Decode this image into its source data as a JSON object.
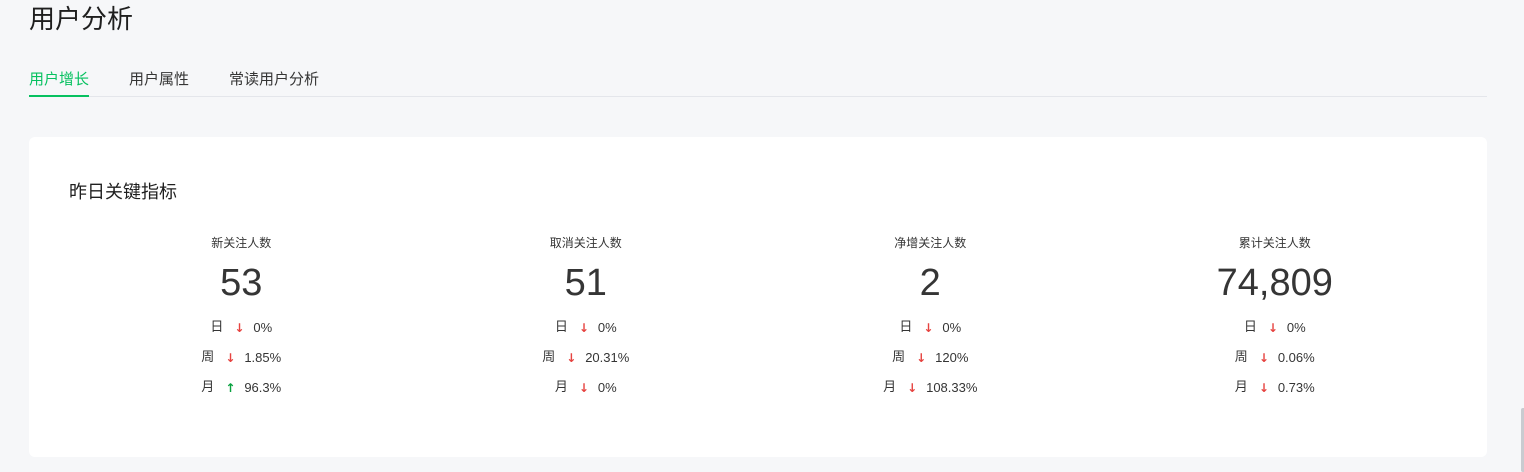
{
  "page": {
    "title": "用户分析"
  },
  "tabs": [
    {
      "label": "用户增长",
      "active": true
    },
    {
      "label": "用户属性",
      "active": false
    },
    {
      "label": "常读用户分析",
      "active": false
    }
  ],
  "card": {
    "title": "昨日关键指标"
  },
  "periods": {
    "day": "日",
    "week": "周",
    "month": "月"
  },
  "metrics": [
    {
      "label": "新关注人数",
      "value": "53",
      "day": {
        "direction": "down",
        "pct": "0%"
      },
      "week": {
        "direction": "down",
        "pct": "1.85%"
      },
      "month": {
        "direction": "up",
        "pct": "96.3%"
      }
    },
    {
      "label": "取消关注人数",
      "value": "51",
      "day": {
        "direction": "down",
        "pct": "0%"
      },
      "week": {
        "direction": "down",
        "pct": "20.31%"
      },
      "month": {
        "direction": "down",
        "pct": "0%"
      }
    },
    {
      "label": "净增关注人数",
      "value": "2",
      "day": {
        "direction": "down",
        "pct": "0%"
      },
      "week": {
        "direction": "down",
        "pct": "120%"
      },
      "month": {
        "direction": "down",
        "pct": "108.33%"
      }
    },
    {
      "label": "累计关注人数",
      "value": "74,809",
      "day": {
        "direction": "down",
        "pct": "0%"
      },
      "week": {
        "direction": "down",
        "pct": "0.06%"
      },
      "month": {
        "direction": "down",
        "pct": "0.73%"
      }
    }
  ],
  "colors": {
    "accent": "#07c160",
    "down": "#e64340",
    "up": "#07a13e",
    "background": "#f6f7f9",
    "card": "#ffffff"
  }
}
